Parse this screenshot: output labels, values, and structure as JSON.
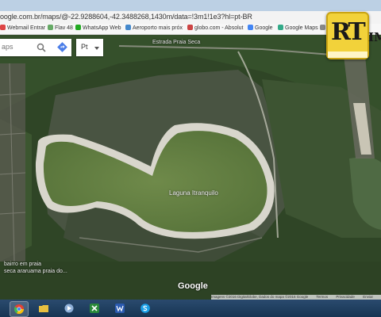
{
  "browser": {
    "url": "oogle.com.br/maps/@-22.9288604,-42.3488268,1430m/data=!3m1!1e3?hl=pt-BR",
    "bookmarks": [
      {
        "label": "Webmail Entrar",
        "color": "#d44"
      },
      {
        "label": "Flav 48",
        "color": "#6a6"
      },
      {
        "label": "WhatsApp Web",
        "color": "#2a2"
      },
      {
        "label": "Aeroporto mais próx",
        "color": "#48c"
      },
      {
        "label": "globo.com - Absolut",
        "color": "#c44"
      },
      {
        "label": "Google",
        "color": "#4285f4"
      },
      {
        "label": "Google Maps",
        "color": "#3a8"
      },
      {
        "label": "Ec",
        "color": "#888"
      }
    ]
  },
  "map": {
    "search_placeholder": "aps",
    "language_select": "Pt",
    "lagoon_label": "Laguna Itranquilo",
    "road_label": "Estrada Praia Seca",
    "place_label_line1": "bairro em praia",
    "place_label_line2": "seca araruama praia do...",
    "watermark": "Google",
    "attribution": [
      "Imagens ©2016 DigitalGlobe, Dados do mapa ©2016 Google",
      "Termos",
      "Privacidade",
      "Enviar"
    ]
  },
  "logo": {
    "initials": "RT",
    "side_text": "IM"
  },
  "taskbar": {
    "apps": [
      {
        "name": "chrome-icon",
        "color": "#e34234"
      },
      {
        "name": "folder-icon",
        "color": "#e8c040"
      },
      {
        "name": "media-icon",
        "color": "#8fb0d8"
      },
      {
        "name": "excel-icon",
        "color": "#2a8a3a"
      },
      {
        "name": "word-icon",
        "color": "#2a5ab0"
      },
      {
        "name": "skype-icon",
        "color": "#1aa0e8"
      }
    ]
  }
}
